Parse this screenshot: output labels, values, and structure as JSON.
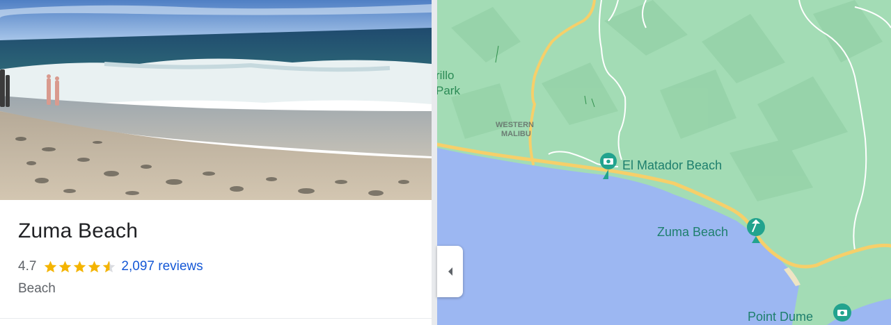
{
  "place": {
    "name": "Zuma Beach",
    "rating": "4.7",
    "rating_stars": 4.7,
    "reviews": "2,097 reviews",
    "category": "Beach"
  },
  "map": {
    "labels": {
      "trillo_line1": "rillo",
      "trillo_line2": "Park",
      "western": "WESTERN",
      "malibu": "MALIBU",
      "el_matador": "El Matador Beach",
      "zuma": "Zuma Beach",
      "point_dume": "Point Dume"
    }
  },
  "icons": {
    "star": "star-icon",
    "half_star": "half-star-icon",
    "collapse": "chevron-left-icon",
    "photo_poi": "camera-icon",
    "beach_poi": "umbrella-icon"
  },
  "colors": {
    "land": "#a3dcb5",
    "water": "#9cb7f2",
    "road": "#f6cf6a",
    "poi": "#22a38e",
    "link": "#1558d6",
    "star": "#f4b400"
  }
}
